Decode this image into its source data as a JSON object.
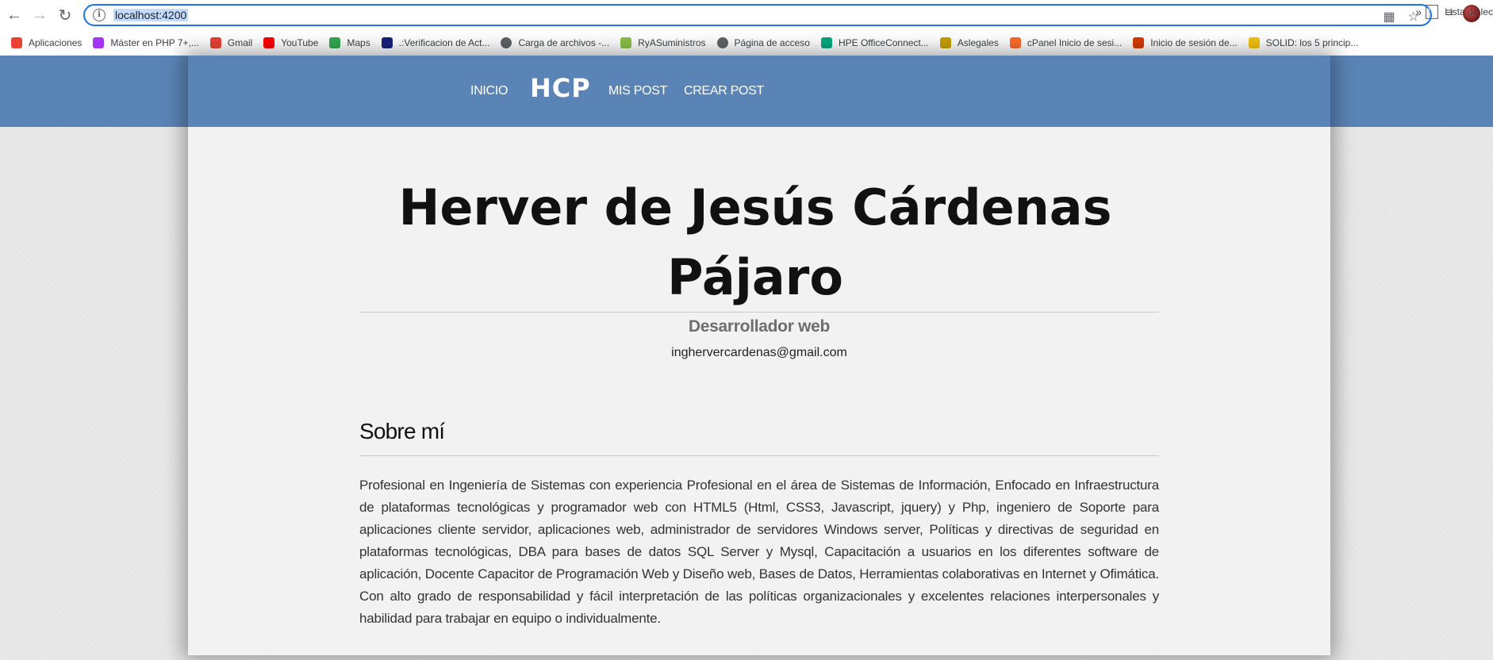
{
  "browser": {
    "url": "localhost:4200",
    "bookmarks": [
      {
        "label": "Aplicaciones",
        "icon": "apps-grid-icon",
        "color": "#e94235"
      },
      {
        "label": "Máster en PHP 7+,...",
        "icon": "udemy-icon",
        "color": "#a435f0"
      },
      {
        "label": "Gmail",
        "icon": "gmail-icon",
        "color": "#ea4335"
      },
      {
        "label": "YouTube",
        "icon": "youtube-icon",
        "color": "#ff0000"
      },
      {
        "label": "Maps",
        "icon": "maps-icon",
        "color": "#34a853"
      },
      {
        "label": ".:Verificacion de Act...",
        "icon": "siap-icon",
        "color": "#1a237e"
      },
      {
        "label": "Carga de archivos -...",
        "icon": "globe-icon",
        "color": "#5f6368"
      },
      {
        "label": "RyASuministros",
        "icon": "ryasuministros-icon",
        "color": "#8bc34a"
      },
      {
        "label": "Página de acceso",
        "icon": "globe-icon",
        "color": "#5f6368"
      },
      {
        "label": "HPE OfficeConnect...",
        "icon": "hpe-icon",
        "color": "#01a982"
      },
      {
        "label": "Aslegales",
        "icon": "aslegales-icon",
        "color": "#c8a200"
      },
      {
        "label": "cPanel Inicio de sesi...",
        "icon": "cpanel-icon",
        "color": "#ff6c2c"
      },
      {
        "label": "Inicio de sesión de...",
        "icon": "office-icon",
        "color": "#d83b01"
      },
      {
        "label": "SOLID: los 5 princip...",
        "icon": "solid-icon",
        "color": "#f4c20d"
      }
    ],
    "more_label": "»",
    "reading_list_label": "Lista de lec"
  },
  "nav": {
    "inicio": "INICIO",
    "brand": "HCP",
    "mis_post": "MIS POST",
    "crear_post": "CREAR POST"
  },
  "profile": {
    "name": "Herver de Jesús Cárdenas Pájaro",
    "role": "Desarrollador web",
    "email": "inghervercardenas@gmail.com"
  },
  "about": {
    "title": "Sobre mí",
    "text": "Profesional en Ingeniería de Sistemas con experiencia Profesional en el área de Sistemas de Información, Enfocado en Infraestructura de plataformas tecnológicas y programador web con HTML5 (Html, CSS3, Javascript, jquery) y Php, ingeniero de Soporte para aplicaciones cliente servidor, aplicaciones web, administrador de servidores Windows server, Políticas y directivas de seguridad en plataformas tecnológicas, DBA para bases de datos SQL Server y Mysql, Capacitación a usuarios en los diferentes software de aplicación, Docente Capacitor de Programación Web y Diseño web, Bases de Datos, Herramientas colaborativas en Internet y Ofimática. Con alto grado de responsabilidad y fácil interpretación de las políticas organizacionales y excelentes relaciones interpersonales y habilidad para trabajar en equipo o individualmente."
  },
  "colors": {
    "header": "#5b84b6",
    "card": "#f2f2f2",
    "background": "#e4e4e4"
  }
}
